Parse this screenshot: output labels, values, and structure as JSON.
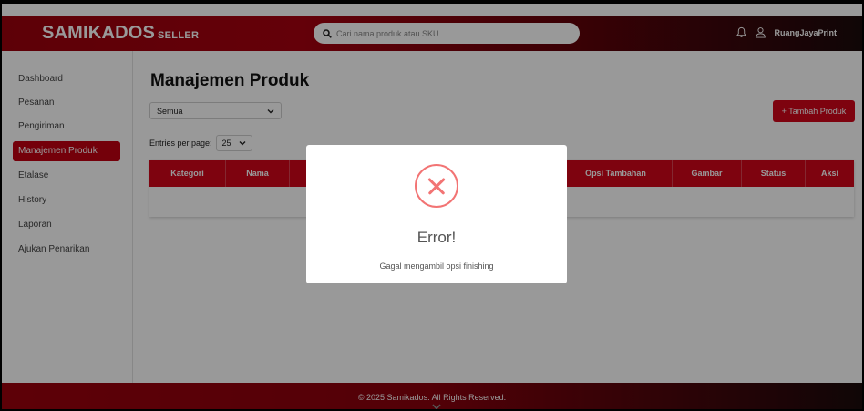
{
  "header": {
    "brand": "SAMIKADOS",
    "brand_suffix": "SELLER",
    "search_placeholder": "Cari nama produk atau SKU...",
    "username": "RuangJayaPrint"
  },
  "sidebar": {
    "items": [
      {
        "label": "Dashboard"
      },
      {
        "label": "Pesanan"
      },
      {
        "label": "Pengiriman"
      },
      {
        "label": "Manajemen Produk",
        "active": true
      },
      {
        "label": "Etalase"
      },
      {
        "label": "History"
      },
      {
        "label": "Laporan"
      },
      {
        "label": "Ajukan Penarikan"
      }
    ]
  },
  "main": {
    "title": "Manajemen Produk",
    "filter_value": "Semua",
    "entries_label": "Entries per page:",
    "entries_value": "25",
    "add_button": "+ Tambah Produk",
    "columns": [
      "Kategori",
      "Nama",
      "",
      "",
      "",
      "Opsi Tambahan",
      "Gambar",
      "Status",
      "Aksi"
    ]
  },
  "footer": {
    "text": "© 2025 Samikados. All Rights Reserved."
  },
  "modal": {
    "title": "Error!",
    "message": "Gagal mengambil opsi finishing"
  },
  "colors": {
    "primary": "#d2061a",
    "error": "#f27474"
  }
}
